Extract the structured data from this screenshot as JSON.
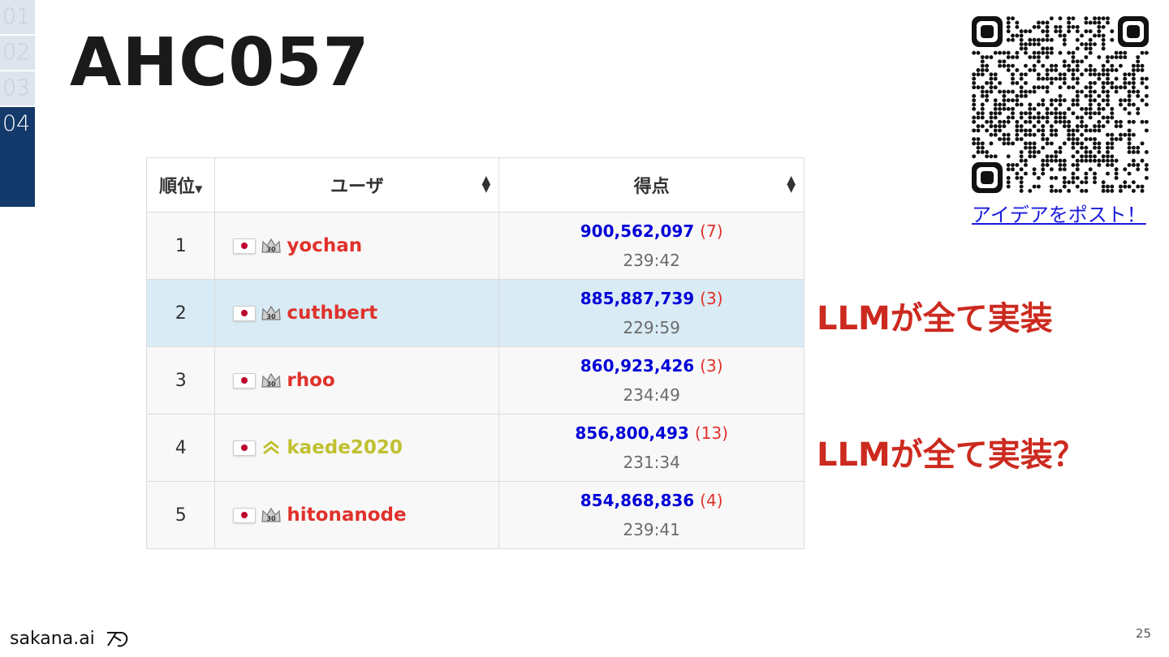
{
  "nav": {
    "items": [
      {
        "label": "01",
        "active": false
      },
      {
        "label": "02",
        "active": false
      },
      {
        "label": "03",
        "active": false
      },
      {
        "label": "04",
        "active": true
      }
    ]
  },
  "slide": {
    "title": "AHC057",
    "page_number": "25"
  },
  "table": {
    "headers": {
      "rank": "順位",
      "user": "ユーザ",
      "score": "得点"
    },
    "rows": [
      {
        "rank": "1",
        "user": "yochan",
        "badge": "crown-icon",
        "score": "900,562,097",
        "submissions": "(7)",
        "time": "239:42"
      },
      {
        "rank": "2",
        "user": "cuthbert",
        "badge": "crown-icon",
        "score": "885,887,739",
        "submissions": "(3)",
        "time": "229:59"
      },
      {
        "rank": "3",
        "user": "rhoo",
        "badge": "crown-icon",
        "score": "860,923,426",
        "submissions": "(3)",
        "time": "234:49"
      },
      {
        "rank": "4",
        "user": "kaede2020",
        "badge": "chevron-up-icon",
        "score": "856,800,493",
        "submissions": "(13)",
        "time": "231:34"
      },
      {
        "rank": "5",
        "user": "hitonanode",
        "badge": "crown-icon",
        "score": "854,868,836",
        "submissions": "(4)",
        "time": "239:41"
      }
    ]
  },
  "annotations": {
    "first": "LLMが全て実装",
    "second": "LLMが全て実装？"
  },
  "qr": {
    "link_text": "アイデアをポスト！"
  },
  "brand": {
    "name": "sakana.ai"
  },
  "colors": {
    "nav_active": "#14396b",
    "user_red": "#e0312b",
    "user_gold": "#c0c030",
    "score_blue": "#0000d8",
    "annotation_red": "#cc2a1f",
    "highlight_row": "#d9ebf5"
  }
}
